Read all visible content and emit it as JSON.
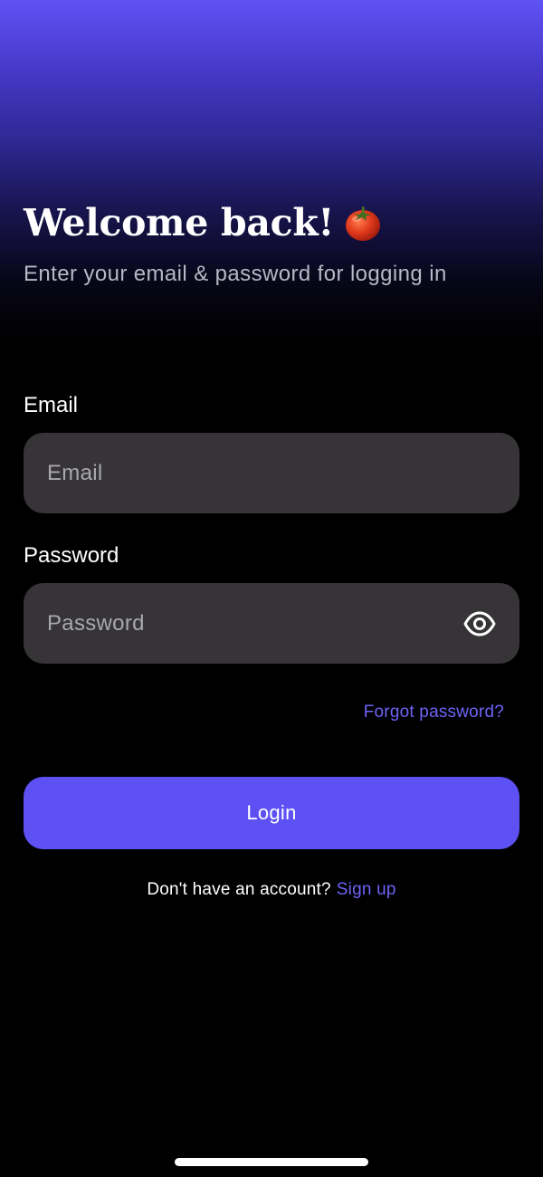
{
  "header": {
    "title": "Welcome back!",
    "title_emoji_icon": "tomato-icon",
    "subtitle": "Enter your email & password for logging in"
  },
  "form": {
    "email_label": "Email",
    "email_placeholder": "Email",
    "email_value": "",
    "password_label": "Password",
    "password_placeholder": "Password",
    "password_value": "",
    "show_password_icon": "eye-icon",
    "forgot_password": "Forgot password?",
    "login_label": "Login"
  },
  "footer": {
    "no_account_text": "Don't have an account?",
    "signup_link": "Sign up"
  },
  "colors": {
    "accent": "#5d51f3",
    "link": "#6f63f6",
    "field_background": "#363437",
    "background": "#000000",
    "gradient_top": "#5f52f5"
  }
}
